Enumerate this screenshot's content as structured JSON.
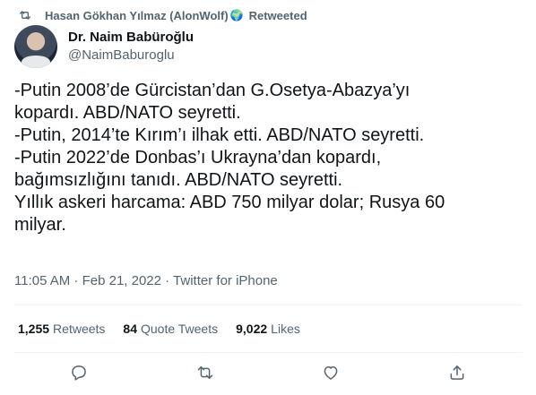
{
  "retweet_header": {
    "name": "Hasan Gökhan Yılmaz (AlonWolf)",
    "emoji": "🌍",
    "label": "Retweeted"
  },
  "author": {
    "display_name": "Dr. Naim Babüroğlu",
    "handle": "@NaimBaburoglu"
  },
  "tweet": {
    "lines": [
      "-Putin 2008’de Gürcistan’dan G.Osetya-Abazya’yı",
      "kopardı. ABD/NATO seyretti.",
      "-Putin, 2014’te Kırım’ı ilhak etti. ABD/NATO seyretti.",
      "-Putin 2022’de Donbas’ı Ukrayna’dan kopardı,",
      "bağımsızlığını tanıdı. ABD/NATO seyretti.",
      "Yıllık askeri harcama: ABD 750 milyar dolar; Rusya 60",
      "milyar."
    ]
  },
  "meta": {
    "text": "11:05 AM · Feb 21, 2022 · Twitter for iPhone"
  },
  "stats": {
    "retweets": {
      "count": "1,255",
      "label": "Retweets"
    },
    "quotes": {
      "count": "84",
      "label": "Quote Tweets"
    },
    "likes": {
      "count": "9,022",
      "label": "Likes"
    }
  },
  "icons": {
    "retweet_header": "retweet-icon",
    "reply": "reply-icon",
    "retweet": "retweet-icon",
    "like": "heart-icon",
    "share": "share-icon"
  },
  "colors": {
    "text": "#0f1419",
    "secondary": "#536471",
    "divider": "#eff3f4"
  }
}
